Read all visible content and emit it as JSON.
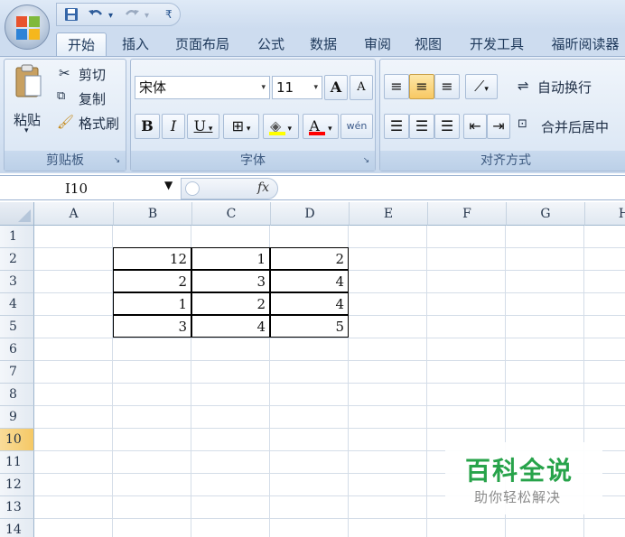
{
  "qat": {
    "save_icon": "save-icon",
    "undo_icon": "undo-icon",
    "redo_icon": "redo-icon",
    "customize_icon": "customize-icon"
  },
  "tabs": [
    {
      "label": "开始",
      "active": true
    },
    {
      "label": "插入"
    },
    {
      "label": "页面布局"
    },
    {
      "label": "公式"
    },
    {
      "label": "数据"
    },
    {
      "label": "审阅"
    },
    {
      "label": "视图"
    },
    {
      "label": "开发工具"
    },
    {
      "label": "福昕阅读器"
    }
  ],
  "clipboard": {
    "paste": "粘贴",
    "cut": "剪切",
    "copy": "复制",
    "format_painter": "格式刷",
    "group_label": "剪贴板"
  },
  "font": {
    "name": "宋体",
    "size": "11",
    "grow": "A",
    "shrink": "A",
    "bold": "B",
    "italic": "I",
    "underline": "U",
    "fill_color": "#ffff00",
    "font_color": "#ff0000",
    "font_color_label": "A",
    "phonetic": "wén",
    "group_label": "字体"
  },
  "alignment": {
    "wrap": "自动换行",
    "merge": "合并后居中",
    "group_label": "对齐方式"
  },
  "formula_bar": {
    "name_box": "I10",
    "fx": "fx",
    "value": ""
  },
  "grid": {
    "columns": [
      "A",
      "B",
      "C",
      "D",
      "E",
      "F",
      "G",
      "H"
    ],
    "rows": [
      "1",
      "2",
      "3",
      "4",
      "5",
      "6",
      "7",
      "8",
      "9",
      "10",
      "11",
      "12",
      "13",
      "14"
    ],
    "active_row": "10",
    "data": [
      [
        "12",
        "1",
        "2"
      ],
      [
        "2",
        "3",
        "4"
      ],
      [
        "1",
        "2",
        "4"
      ],
      [
        "3",
        "4",
        "5"
      ]
    ]
  },
  "watermark": {
    "title": "百科全说",
    "subtitle": "助你轻松解决"
  }
}
